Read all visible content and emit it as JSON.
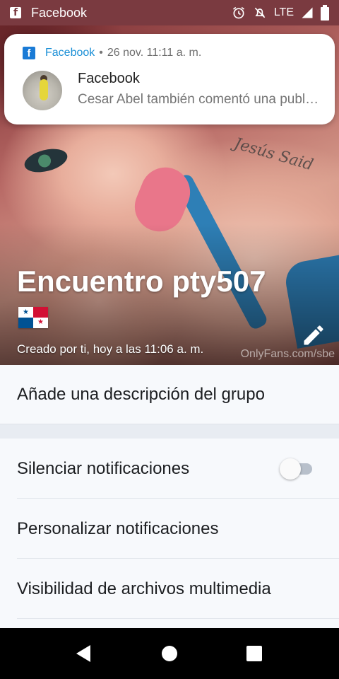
{
  "status_bar": {
    "app_name": "Facebook",
    "network": "LTE",
    "icons": [
      "facebook-icon",
      "alarm-icon",
      "do-not-disturb-icon",
      "signal-icon",
      "battery-icon"
    ]
  },
  "notification": {
    "source": "Facebook",
    "separator": "•",
    "time": "26 nov. 11:11 a. m.",
    "title": "Facebook",
    "message": "Cesar Abel también comentó una publicación",
    "accent": "#1a8fd6"
  },
  "group": {
    "title": "Encuentro pty507",
    "flag": "panama-flag",
    "created": "Creado por ti, hoy a las 11:06 a. m.",
    "watermark": "OnlyFans.com/sbe"
  },
  "list": {
    "description": "Añade una descripción del grupo",
    "mute": "Silenciar notificaciones",
    "mute_enabled": false,
    "customize": "Personalizar notificaciones",
    "media_visibility": "Visibilidad de archivos multimedia"
  },
  "navbar": {
    "icons": [
      "back-icon",
      "home-icon",
      "recents-icon"
    ]
  }
}
